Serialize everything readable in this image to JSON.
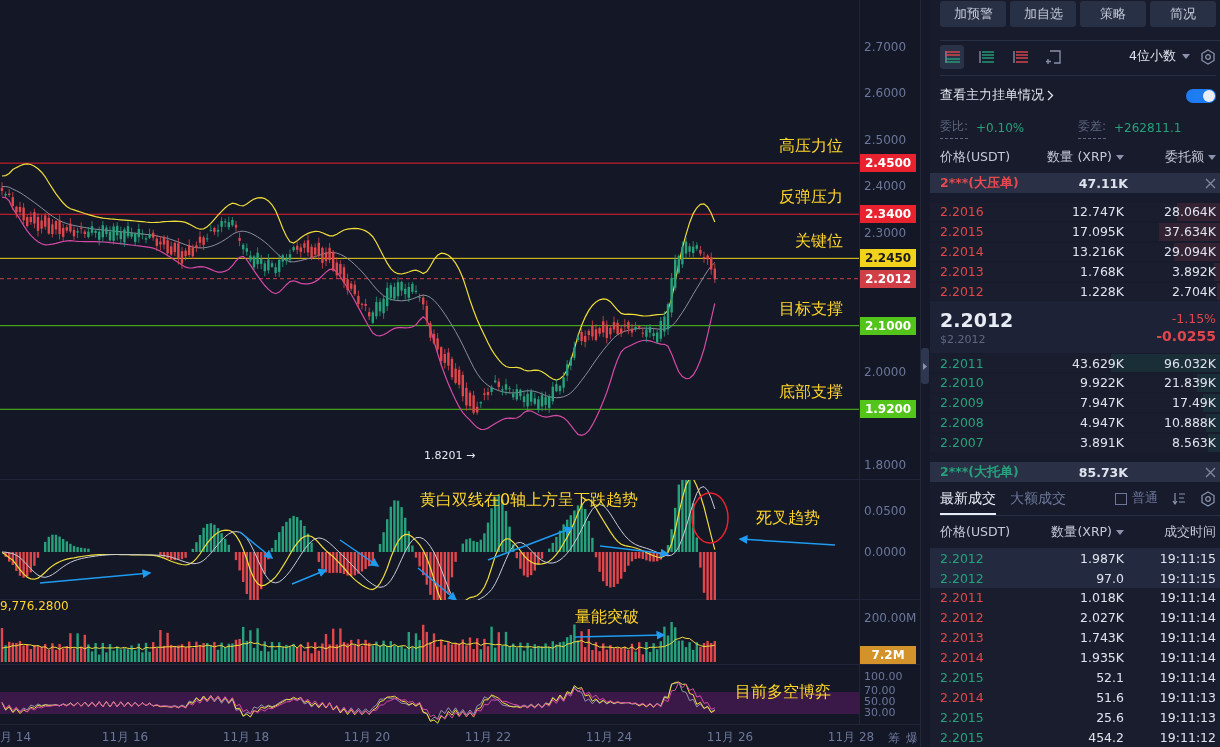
{
  "chart": {
    "price_axis": [
      "2.7000",
      "2.6000",
      "2.5000",
      "2.4000",
      "2.3000",
      "2.0000",
      "1.8000"
    ],
    "levels": [
      {
        "price": "2.4500",
        "note": "高压力位",
        "color": "#e8222e",
        "kind": "line"
      },
      {
        "price": "2.3400",
        "note": "反弹压力",
        "color": "#e8222e",
        "kind": "line"
      },
      {
        "price": "2.2450",
        "note": "关键位",
        "color": "#f2d31b",
        "kind": "line"
      },
      {
        "price": "2.2012",
        "color": "#cf3f45",
        "kind": "current"
      },
      {
        "price": "2.1000",
        "note": "目标支撑",
        "color": "#52c41a",
        "kind": "line"
      },
      {
        "price": "1.9200",
        "note": "底部支撑",
        "color": "#52c41a",
        "kind": "line"
      }
    ],
    "low_marker": "1.8201 →",
    "macd": {
      "axis": [
        "0.0500",
        "0.0000"
      ],
      "note": "黄白双线在0轴上方呈下跌趋势",
      "note_2": "死叉趋势"
    },
    "volume": {
      "reading": "9,776.2800",
      "axis": [
        "200.00M"
      ],
      "tag": "7.2M",
      "note": "量能突破"
    },
    "rsi": {
      "axis": [
        "100.00",
        "70.00",
        "50.00",
        "30.00"
      ],
      "note": "目前多空博弈"
    },
    "dates": [
      "月 14",
      "11月 16",
      "11月 18",
      "11月 20",
      "11月 22",
      "11月 24",
      "11月 26",
      "11月 28"
    ],
    "axis_buttons": [
      "筹",
      "爆"
    ]
  },
  "actions": [
    "加预警",
    "加自选",
    "策略",
    "简况"
  ],
  "views": [
    {
      "kind": "both",
      "selected": true
    },
    {
      "kind": "bids",
      "selected": false
    },
    {
      "kind": "asks",
      "selected": false
    },
    {
      "kind": "custom",
      "selected": false
    }
  ],
  "precision": "4位小数",
  "main_orders": {
    "label": "查看主力挂单情况",
    "on": true
  },
  "ratio": {
    "label": "委比:",
    "value": "+0.10%"
  },
  "diff": {
    "label": "委差:",
    "value": "+262811.1"
  },
  "book_header": [
    "价格(USDT)",
    "数量 (XRP)",
    "委托额"
  ],
  "big_ask": {
    "price": "2***(大压单)",
    "amount": "47.11K"
  },
  "asks": [
    {
      "price": "2.2016",
      "amount": "12.747K",
      "total": "28.064K",
      "level": 0.15
    },
    {
      "price": "2.2015",
      "amount": "17.095K",
      "total": "37.634K",
      "level": 0.21
    },
    {
      "price": "2.2014",
      "amount": "13.216K",
      "total": "29.094K",
      "level": 0.16
    },
    {
      "price": "2.2013",
      "amount": "1.768K",
      "total": "3.892K",
      "level": 0.02
    },
    {
      "price": "2.2012",
      "amount": "1.228K",
      "total": "2.704K",
      "level": 0.01
    }
  ],
  "last": {
    "price": "2.2012",
    "usd": "$2.2012",
    "change_pct": "-1.15%",
    "change": "-0.0255"
  },
  "bids": [
    {
      "price": "2.2011",
      "amount": "43.629K",
      "total": "96.032K",
      "level": 0.375
    },
    {
      "price": "2.2010",
      "amount": "9.922K",
      "total": "21.839K",
      "level": 0.08
    },
    {
      "price": "2.2009",
      "amount": "7.947K",
      "total": "17.49K",
      "level": 0.06
    },
    {
      "price": "2.2008",
      "amount": "4.947K",
      "total": "10.888K",
      "level": 0.05
    },
    {
      "price": "2.2007",
      "amount": "3.891K",
      "total": "8.563K",
      "level": 0.04
    }
  ],
  "big_bid": {
    "price": "2***(大托单)",
    "amount": "85.73K"
  },
  "trade_tabs": [
    {
      "label": "最新成交",
      "selected": true
    },
    {
      "label": "大额成交",
      "selected": false
    }
  ],
  "normal_filter": {
    "label": "普通",
    "checked": false
  },
  "trade_header": [
    "价格(USDT)",
    "数量(XRP)",
    "成交时间"
  ],
  "trades": [
    {
      "price": "2.2012",
      "amount": "1.987K",
      "time": "19:11:15",
      "kind": "buy",
      "highlighted": true
    },
    {
      "price": "2.2012",
      "amount": "97.0",
      "time": "19:11:15",
      "kind": "buy",
      "highlighted": true
    },
    {
      "price": "2.2011",
      "amount": "1.018K",
      "time": "19:11:14",
      "kind": "sell",
      "highlighted": false
    },
    {
      "price": "2.2012",
      "amount": "2.027K",
      "time": "19:11:14",
      "kind": "sell",
      "highlighted": false
    },
    {
      "price": "2.2013",
      "amount": "1.743K",
      "time": "19:11:14",
      "kind": "sell",
      "highlighted": false
    },
    {
      "price": "2.2014",
      "amount": "1.935K",
      "time": "19:11:14",
      "kind": "sell",
      "highlighted": false
    },
    {
      "price": "2.2015",
      "amount": "52.1",
      "time": "19:11:14",
      "kind": "buy",
      "highlighted": false
    },
    {
      "price": "2.2014",
      "amount": "51.6",
      "time": "19:11:13",
      "kind": "sell",
      "highlighted": false
    },
    {
      "price": "2.2015",
      "amount": "25.6",
      "time": "19:11:13",
      "kind": "buy",
      "highlighted": false
    },
    {
      "price": "2.2015",
      "amount": "454.2",
      "time": "19:11:12",
      "kind": "buy",
      "highlighted": false
    }
  ]
}
